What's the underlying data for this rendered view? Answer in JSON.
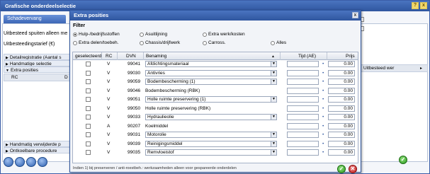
{
  "window": {
    "title": "Grafische onderdeelselectie",
    "help_icon": "?",
    "close_icon": "x"
  },
  "background": {
    "tab_label": "Schadevervang",
    "line1": "Uitbesteed spuiten alleen me",
    "line2": "Uitbesteedingstarief (€)",
    "sections": [
      {
        "label": "Detailregistratie (Aantal s"
      },
      {
        "label": "Handmatige selectie"
      },
      {
        "label": "Extra posities"
      }
    ],
    "columns": {
      "rc": "RC",
      "d": "D"
    },
    "right_header": "Uitbesteed wer",
    "bottom_sections": [
      {
        "label": "Handmatig verwijderde p"
      },
      {
        "label": "Ontkoelbare procedure"
      }
    ]
  },
  "modal": {
    "title": "Extra posities",
    "close_icon": "x",
    "filter_label": "Filter",
    "radios": [
      {
        "label": "Hulp-/bedrijfsstoffen",
        "checked": true
      },
      {
        "label": "Asuitlijning",
        "checked": false
      },
      {
        "label": "Extra werk/kosten",
        "checked": false
      },
      {
        "label": "Extra delen/toebeh.",
        "checked": false
      },
      {
        "label": "Chassis/drijfwerk",
        "checked": false
      },
      {
        "label": "Carross.",
        "checked": false
      },
      {
        "label": "Alles",
        "checked": false
      }
    ],
    "columns": {
      "geselecteerd": "geselecteerd",
      "rc": "RC",
      "dvn": "DVN",
      "benaming": "Benaming",
      "sort": "▲",
      "tijd": "Tijd (AE)",
      "prijs": "Prijs"
    },
    "rows": [
      {
        "rc": "V",
        "dvn": "99041",
        "benaming": "Afdichtingsmateriaal",
        "type": "select",
        "prijs": "0.00"
      },
      {
        "rc": "V",
        "dvn": "99030",
        "benaming": "Antivries",
        "type": "select",
        "prijs": "0.00"
      },
      {
        "rc": "V",
        "dvn": "99059",
        "benaming": "Bodembescherming (1)",
        "type": "select",
        "prijs": "0.00"
      },
      {
        "rc": "V",
        "dvn": "99046",
        "benaming": "Bodembescherming (RBK)",
        "type": "text",
        "prijs": "0.00"
      },
      {
        "rc": "V",
        "dvn": "99051",
        "benaming": "Holle ruimte preservering (1)",
        "type": "select",
        "prijs": "0.00"
      },
      {
        "rc": "V",
        "dvn": "99050",
        "benaming": "Holle ruimte preservering (RBK)",
        "type": "text",
        "prijs": "0.00"
      },
      {
        "rc": "V",
        "dvn": "99033",
        "benaming": "Hydraulieolie",
        "type": "select",
        "prijs": "0.00"
      },
      {
        "rc": "A",
        "dvn": "90207",
        "benaming": "Koelmiddel",
        "type": "text",
        "prijs": "0.00"
      },
      {
        "rc": "V",
        "dvn": "99031",
        "benaming": "Motorolie",
        "type": "select",
        "prijs": "0.00"
      },
      {
        "rc": "V",
        "dvn": "99039",
        "benaming": "Reinigingsmiddel",
        "type": "select",
        "prijs": "0.00"
      },
      {
        "rc": "V",
        "dvn": "99035",
        "benaming": "Remvloeistof",
        "type": "select",
        "prijs": "0.00"
      }
    ],
    "footnote": "Indien 1) bij preserveren / anti-roestbeh.: werkzaamheden alleen voor gespareerde onderdelen",
    "ok_icon": "✓",
    "cancel_icon": "✕"
  },
  "bg_ok_icon": "✓"
}
